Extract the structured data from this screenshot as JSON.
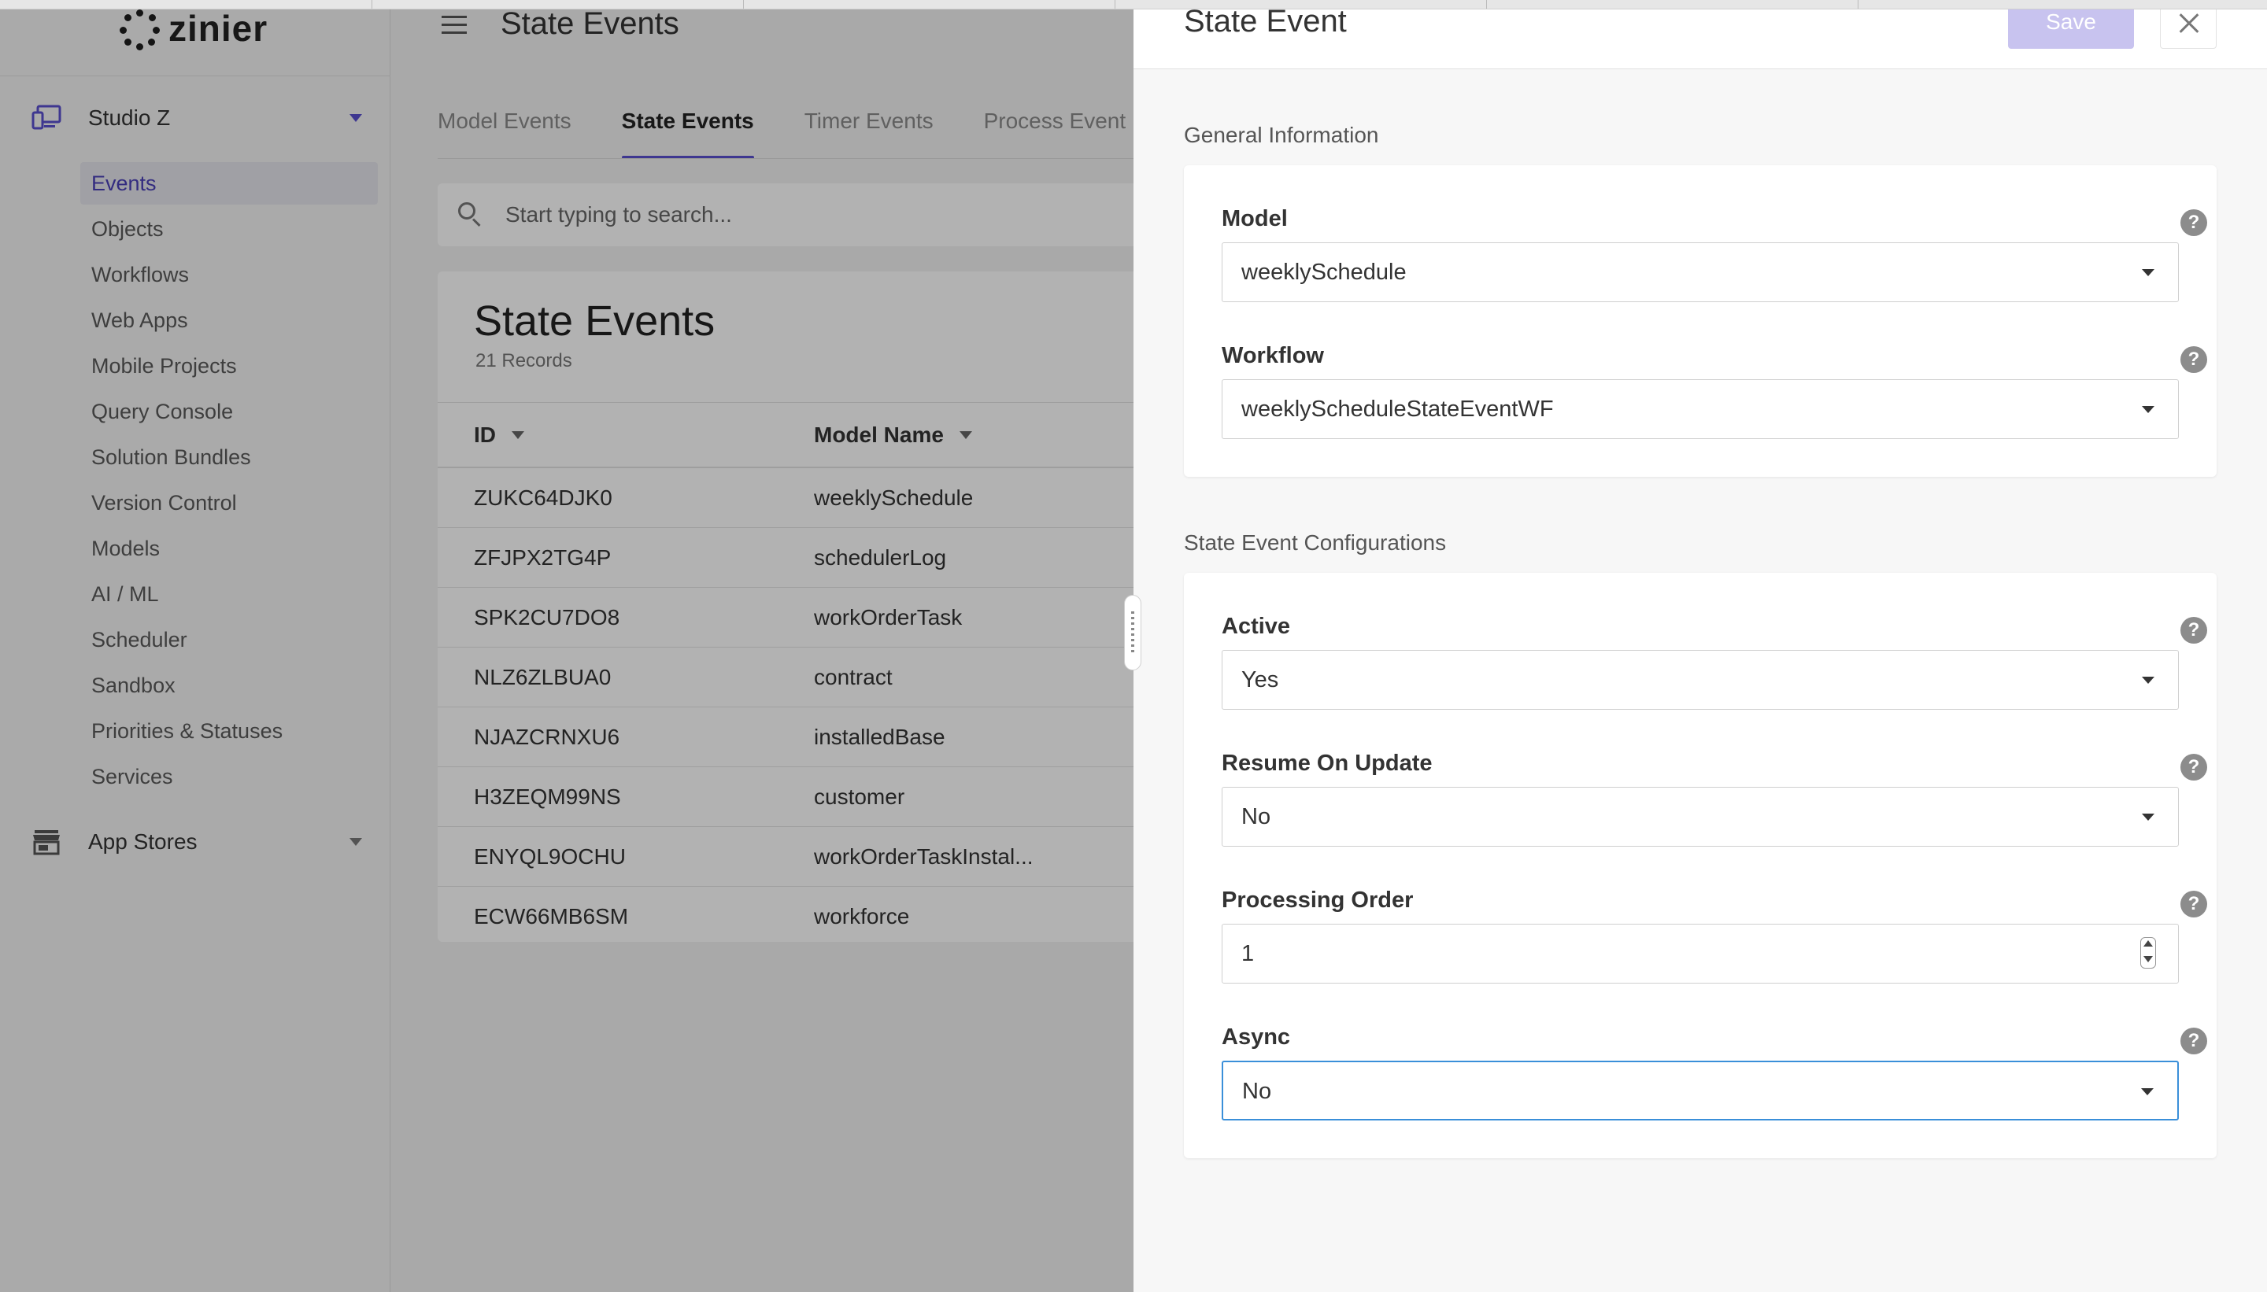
{
  "brand": {
    "name": "zinier"
  },
  "sidebar": {
    "section": {
      "label": "Studio Z",
      "icon": "desktop-icon"
    },
    "items": [
      {
        "label": "Events",
        "active": true
      },
      {
        "label": "Objects"
      },
      {
        "label": "Workflows"
      },
      {
        "label": "Web Apps"
      },
      {
        "label": "Mobile Projects"
      },
      {
        "label": "Query Console"
      },
      {
        "label": "Solution Bundles"
      },
      {
        "label": "Version Control"
      },
      {
        "label": "Models"
      },
      {
        "label": "AI / ML"
      },
      {
        "label": "Scheduler"
      },
      {
        "label": "Sandbox"
      },
      {
        "label": "Priorities & Statuses"
      },
      {
        "label": "Services"
      }
    ],
    "app_stores": {
      "label": "App Stores",
      "icon": "store-icon"
    }
  },
  "header": {
    "title": "State Events"
  },
  "tabs": [
    "Model Events",
    "State Events",
    "Timer Events",
    "Process Event"
  ],
  "search": {
    "placeholder": "Start typing to search..."
  },
  "table": {
    "title": "State Events",
    "record_count": "21 Records",
    "columns": [
      "ID",
      "Model Name"
    ],
    "rows": [
      [
        "ZUKC64DJK0",
        "weeklySchedule"
      ],
      [
        "ZFJPX2TG4P",
        "schedulerLog"
      ],
      [
        "SPK2CU7DO8",
        "workOrderTask"
      ],
      [
        "NLZ6ZLBUA0",
        "contract"
      ],
      [
        "NJAZCRNXU6",
        "installedBase"
      ],
      [
        "H3ZEQM99NS",
        "customer"
      ],
      [
        "ENYQL9OCHU",
        "workOrderTaskInstal..."
      ],
      [
        "ECW66MB6SM",
        "workforce"
      ]
    ]
  },
  "drawer": {
    "title": "State Event",
    "save_label": "Save",
    "general_section": "General Information",
    "model": {
      "label": "Model",
      "value": "weeklySchedule"
    },
    "workflow": {
      "label": "Workflow",
      "value": "weeklyScheduleStateEventWF"
    },
    "config_section": "State Event Configurations",
    "active": {
      "label": "Active",
      "value": "Yes"
    },
    "resume_on_update": {
      "label": "Resume On Update",
      "value": "No"
    },
    "processing_order": {
      "label": "Processing Order",
      "value": "1"
    },
    "async": {
      "label": "Async",
      "value": "No"
    },
    "help_glyph": "?"
  },
  "colors": {
    "accent": "#5a4fcf",
    "save_disabled": "#c8c3ef",
    "focus": "#3a8fd9"
  }
}
